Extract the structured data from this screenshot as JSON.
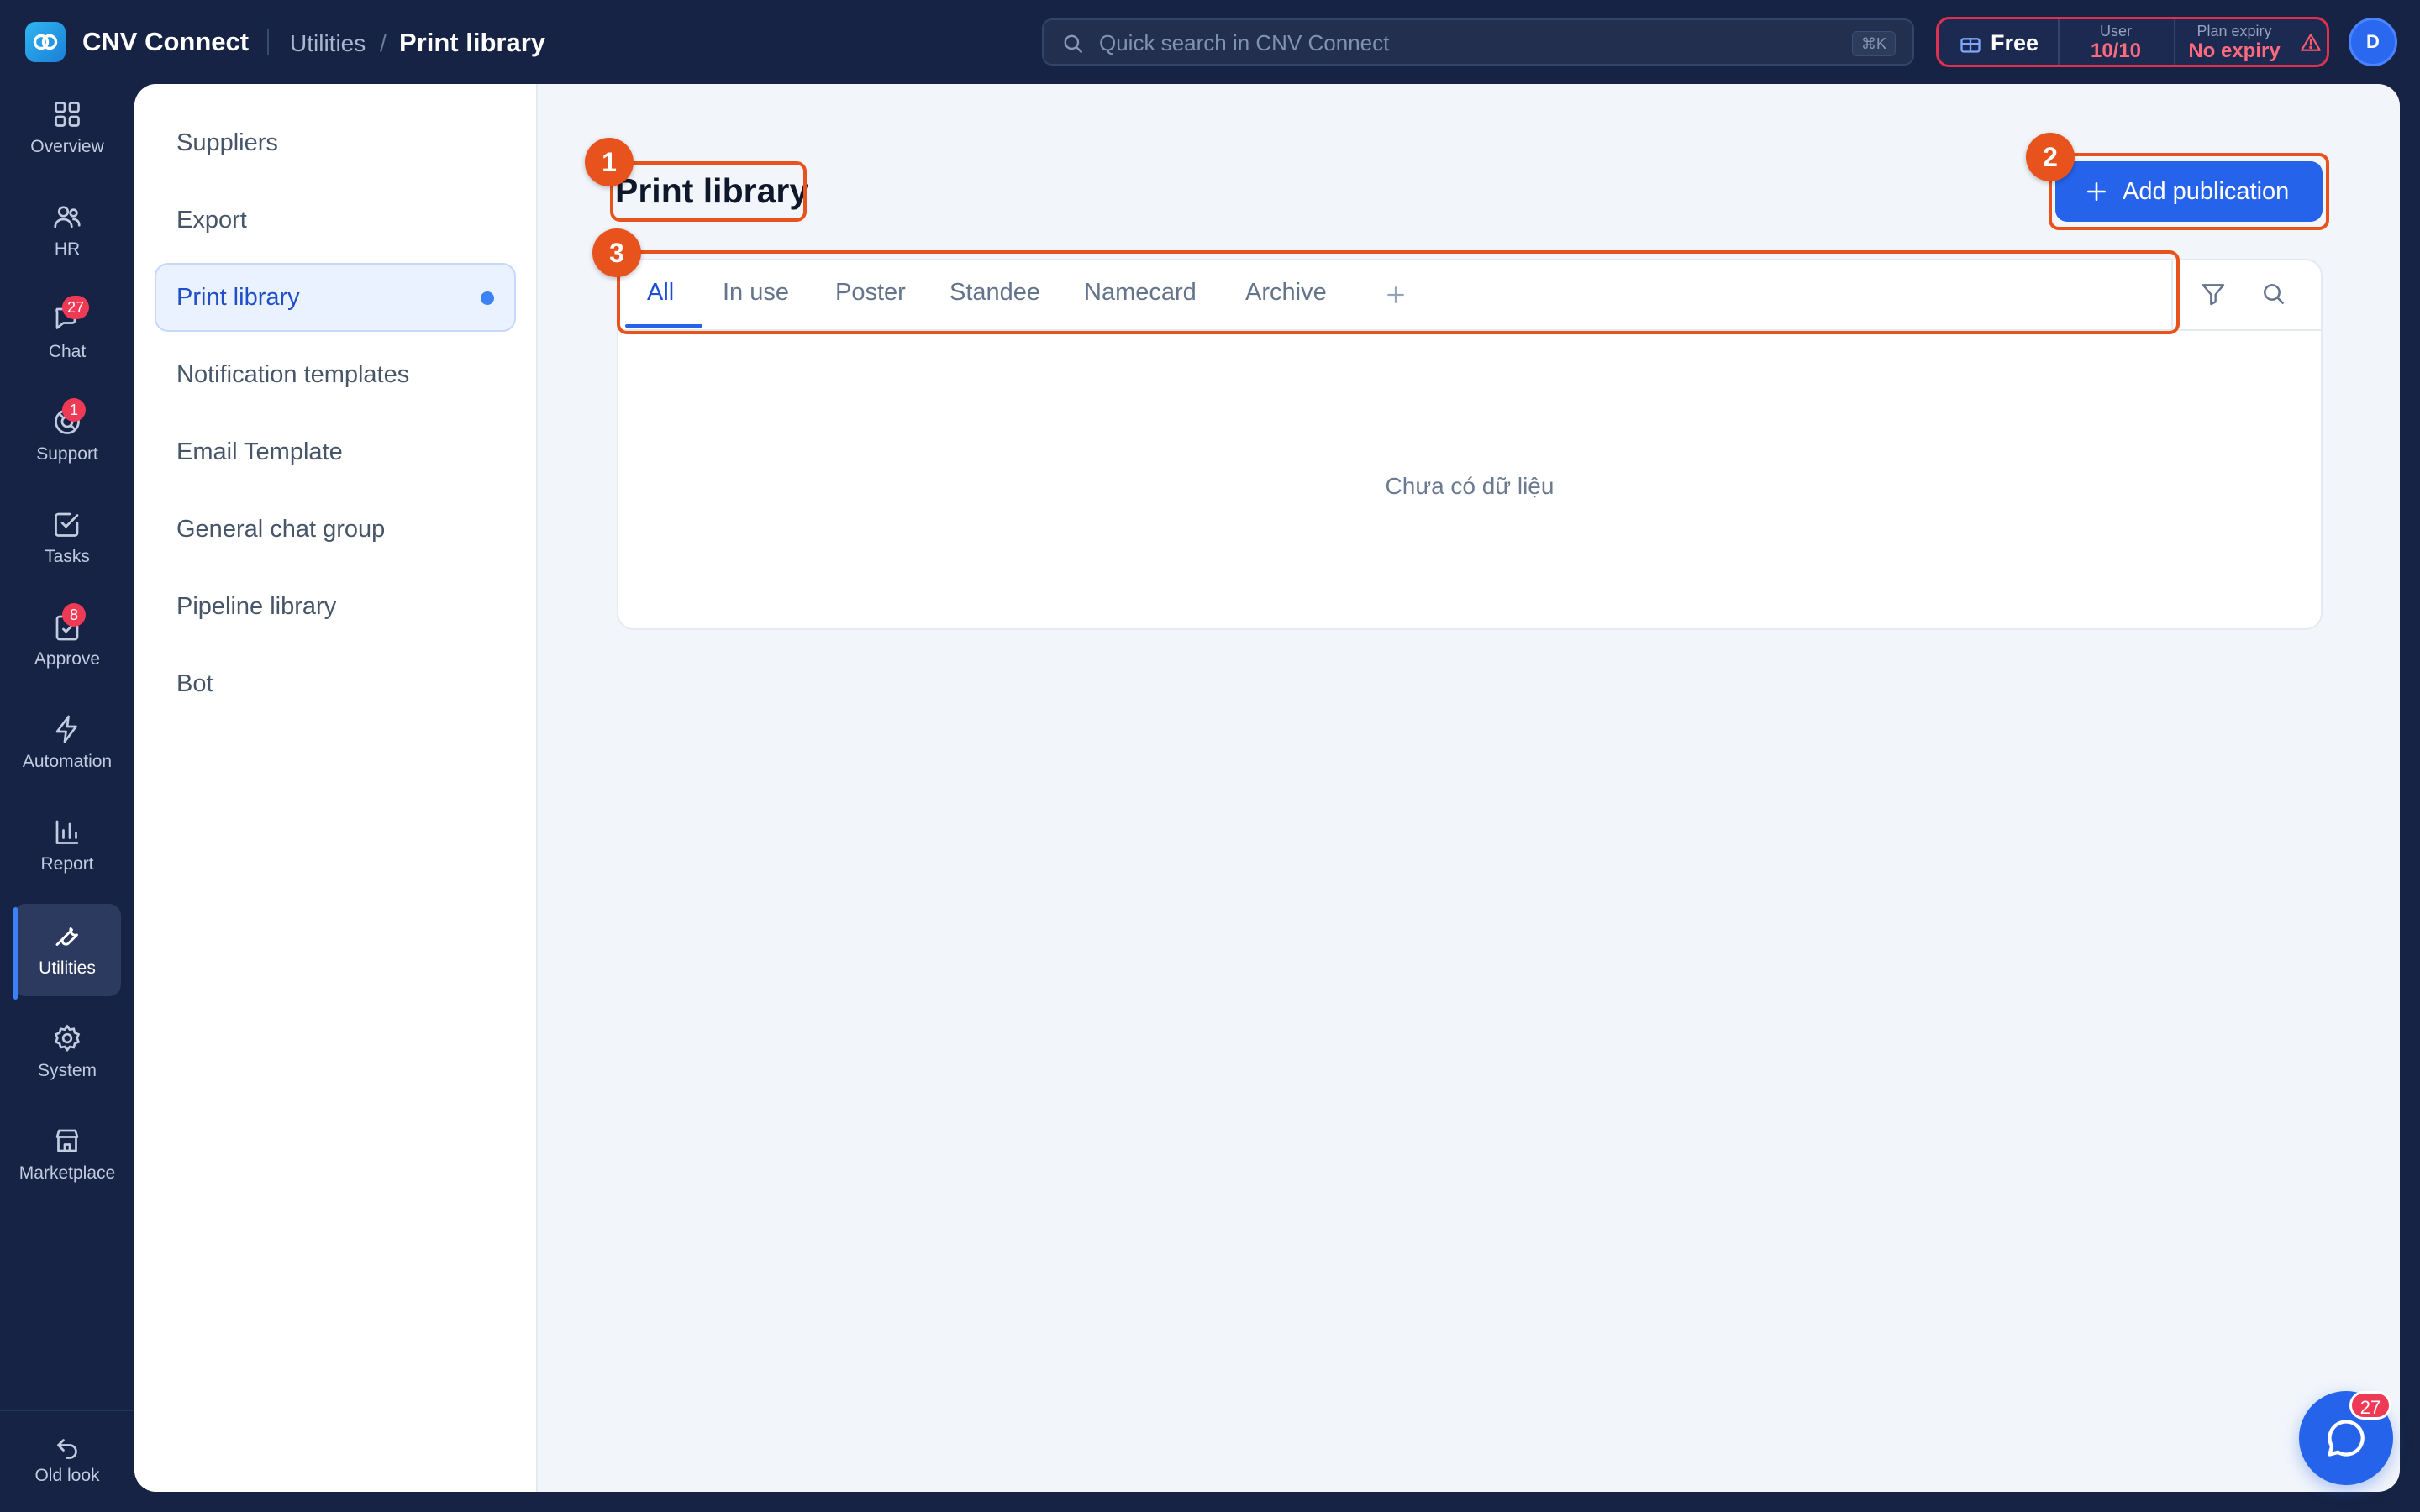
{
  "app": {
    "name": "CNV Connect"
  },
  "breadcrumb": {
    "parent": "Utilities",
    "separator": "/",
    "current": "Print library"
  },
  "search": {
    "placeholder": "Quick search in CNV Connect",
    "shortcut": "⌘K"
  },
  "plan": {
    "name": "Free",
    "user_label": "User",
    "user_value": "10/10",
    "expiry_label": "Plan expiry",
    "expiry_value": "No expiry"
  },
  "avatar": {
    "initial": "D"
  },
  "rail": {
    "items": [
      {
        "label": "Overview",
        "icon": "grid-icon"
      },
      {
        "label": "HR",
        "icon": "users-icon"
      },
      {
        "label": "Chat",
        "icon": "chat-icon",
        "badge": "27"
      },
      {
        "label": "Support",
        "icon": "support-icon",
        "badge": "1"
      },
      {
        "label": "Tasks",
        "icon": "task-check-icon"
      },
      {
        "label": "Approve",
        "icon": "approve-icon",
        "badge": "8"
      },
      {
        "label": "Automation",
        "icon": "lightning-icon"
      },
      {
        "label": "Report",
        "icon": "bar-chart-icon"
      },
      {
        "label": "Utilities",
        "icon": "wrench-icon",
        "active": true
      },
      {
        "label": "System",
        "icon": "gear-icon"
      },
      {
        "label": "Marketplace",
        "icon": "store-icon"
      }
    ],
    "old_look": "Old look"
  },
  "subnav": {
    "items": [
      {
        "label": "Suppliers"
      },
      {
        "label": "Export"
      },
      {
        "label": "Print library",
        "active": true
      },
      {
        "label": "Notification templates"
      },
      {
        "label": "Email Template"
      },
      {
        "label": "General chat group"
      },
      {
        "label": "Pipeline library"
      },
      {
        "label": "Bot"
      }
    ]
  },
  "main": {
    "title": "Print library",
    "add_button": "Add publication",
    "tabs": [
      {
        "label": "All",
        "active": true
      },
      {
        "label": "In use"
      },
      {
        "label": "Poster"
      },
      {
        "label": "Standee"
      },
      {
        "label": "Namecard"
      },
      {
        "label": "Archive"
      }
    ],
    "empty_text": "Chưa có dữ liệu"
  },
  "annotations": [
    "1",
    "2",
    "3"
  ],
  "chat_fab": {
    "badge": "27"
  },
  "colors": {
    "background": "#162344",
    "accent": "#2563eb",
    "annotation": "#e8531d",
    "badge": "#ef3a55"
  }
}
